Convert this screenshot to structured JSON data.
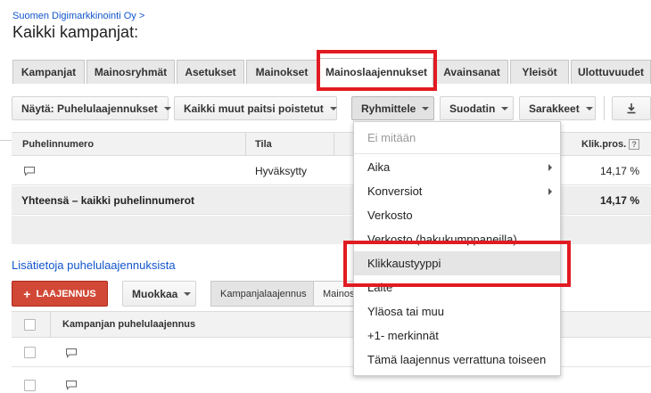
{
  "breadcrumb": "Suomen Digimarkkinointi Oy >",
  "page_title": "Kaikki kampanjat:",
  "tabs": [
    {
      "label": "Kampanjat"
    },
    {
      "label": "Mainosryhmät"
    },
    {
      "label": "Asetukset"
    },
    {
      "label": "Mainokset"
    },
    {
      "label": "Mainoslaajennukset"
    },
    {
      "label": "Avainsanat"
    },
    {
      "label": "Yleisöt"
    },
    {
      "label": "Ulottuvuudet"
    }
  ],
  "active_tab": "Mainoslaajennukset",
  "toolbar": {
    "view_label": "Näytä: Puhelulaajennukset",
    "filter_status_label": "Kaikki muut paitsi poistetut",
    "segment_label": "Ryhmittele",
    "filter_label": "Suodatin",
    "columns_label": "Sarakkeet",
    "download_icon": "download-icon"
  },
  "table": {
    "columns": [
      "Puhelinnumero",
      "Tila",
      "Klik.pros."
    ],
    "help_glyph": "?",
    "rows": [
      {
        "icon": "chat-icon",
        "status": "Hyväksytty",
        "ctr": "14,17 %"
      }
    ],
    "total": {
      "label": "Yhteensä – kaikki puhelinnumerot",
      "ctr": "14,17 %"
    }
  },
  "more_info_link": "Lisätietoja puhelulaajennuksista",
  "extension_button": {
    "icon": "plus-icon",
    "label": "LAAJENNUS"
  },
  "edit_button": "Muokkaa",
  "level_toggle": [
    "Kampanjalaajennus",
    "Mainos"
  ],
  "list_header": "Kampanjan puhelulaajennus",
  "dropdown": {
    "items": [
      {
        "label": "Ei mitään",
        "disabled": true
      },
      {
        "label": "Aika",
        "submenu": true
      },
      {
        "label": "Konversiot",
        "submenu": true
      },
      {
        "label": "Verkosto"
      },
      {
        "label": "Verkosto (hakukumppaneilla)"
      },
      {
        "label": "Klikkaustyyppi",
        "highlighted": true
      },
      {
        "label": "Laite"
      },
      {
        "label": "Yläosa tai muu"
      },
      {
        "label": "+1- merkinnät"
      },
      {
        "label": "Tämä laajennus verrattuna toiseen"
      }
    ]
  },
  "colors": {
    "link": "#1155cc",
    "accent_red": "#d14836",
    "annotation_red": "#e11b22"
  }
}
